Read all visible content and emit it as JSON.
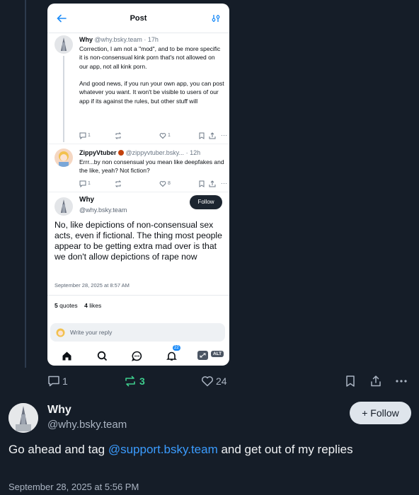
{
  "embedded_screenshot": {
    "header": {
      "title": "Post",
      "back_icon": "arrow-left-icon",
      "filter_icon": "sliders-icon"
    },
    "posts": [
      {
        "author_name": "Why",
        "author_handle": "@why.bsky.team",
        "time": "· 17h",
        "text": "Correction, I am not a \"mod\", and to be more specific it is non-consensual kink porn that's not allowed on our app, not all kink porn.\n\nAnd good news, if you run your own app, you can post whatever you want. It won't be visible to users of our app if its against the rules, but other stuff will",
        "replies": "1",
        "reposts": "",
        "likes": "1"
      },
      {
        "author_name": "ZippyVtuber",
        "author_handle": "@zippyvtuber.bsky...",
        "time": "· 12h",
        "text": "Errr...by non consensual you mean like deepfakes and the like, yeah? Not fiction?",
        "replies": "1",
        "reposts": "",
        "likes": "8"
      }
    ],
    "main_post": {
      "author_name": "Why",
      "author_handle": "@why.bsky.team",
      "follow_label": "Follow",
      "text": "No, like depictions of non-consensual sex acts, even if fictional. The thing most people appear to be getting extra mad over is that we don't allow depictions of rape now",
      "date": "September 28, 2025 at 8:57 AM",
      "quotes_count": "5",
      "quotes_label": "quotes",
      "likes_count": "4",
      "likes_label": "likes"
    },
    "reply_placeholder": "Write your reply",
    "nav": {
      "notifications_badge": "22",
      "alt_label": "ALT"
    }
  },
  "outer_actions": {
    "replies": "1",
    "reposts": "3",
    "likes": "24",
    "repost_color": "#3ecf8e"
  },
  "reply_post": {
    "author_name": "Why",
    "author_handle": "@why.bsky.team",
    "follow_label": "+ Follow",
    "text_before": "Go ahead and tag ",
    "mention": "@support.bsky.team",
    "text_after": " and get out of my replies",
    "date": "September 28, 2025 at 5:56 PM"
  }
}
